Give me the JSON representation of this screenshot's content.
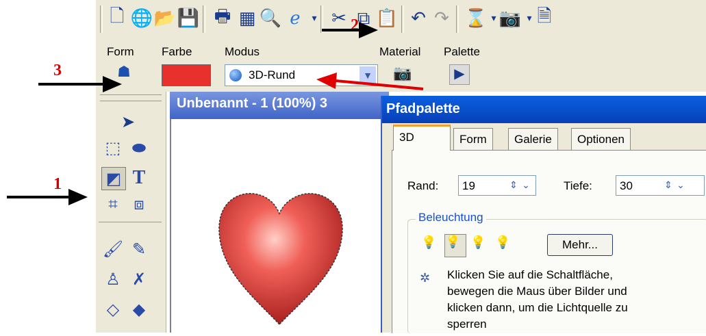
{
  "toolbar": {
    "icons": [
      "new-document-icon",
      "open-web-icon",
      "open-folder-icon",
      "save-icon",
      "print-icon",
      "scan-icon",
      "print-preview-icon",
      "browser-icon",
      "cut-icon",
      "copy-icon",
      "paste-icon",
      "undo-icon",
      "redo-icon",
      "hourglass-icon",
      "camera-icon",
      "document-icon"
    ]
  },
  "propbar": {
    "form_label": "Form",
    "farbe_label": "Farbe",
    "modus_label": "Modus",
    "material_label": "Material",
    "palette_label": "Palette",
    "modus_value": "3D-Rund",
    "color": "#e8302c"
  },
  "document": {
    "title": "Unbenannt - 1 (100%) 3"
  },
  "palette": {
    "title": "Pfadpalette",
    "tabs": [
      "3D",
      "Form",
      "Galerie",
      "Optionen"
    ],
    "active_tab": "3D",
    "rand_label": "Rand:",
    "rand_value": "19",
    "tiefe_label": "Tiefe:",
    "tiefe_value": "30",
    "lighting_group": "Beleuchtung",
    "mehr_button": "Mehr...",
    "hint_line1": "Klicken Sie auf die Schaltfläche,",
    "hint_line2": "bewegen die Maus über Bilder und",
    "hint_line3": "klicken dann, um die Lichtquelle zu",
    "hint_line4": "sperren"
  },
  "annotations": {
    "num1": "1",
    "num2": "2",
    "num3": "3",
    "arrow_color": "#000000",
    "red_arrow_color": "#e00000"
  }
}
